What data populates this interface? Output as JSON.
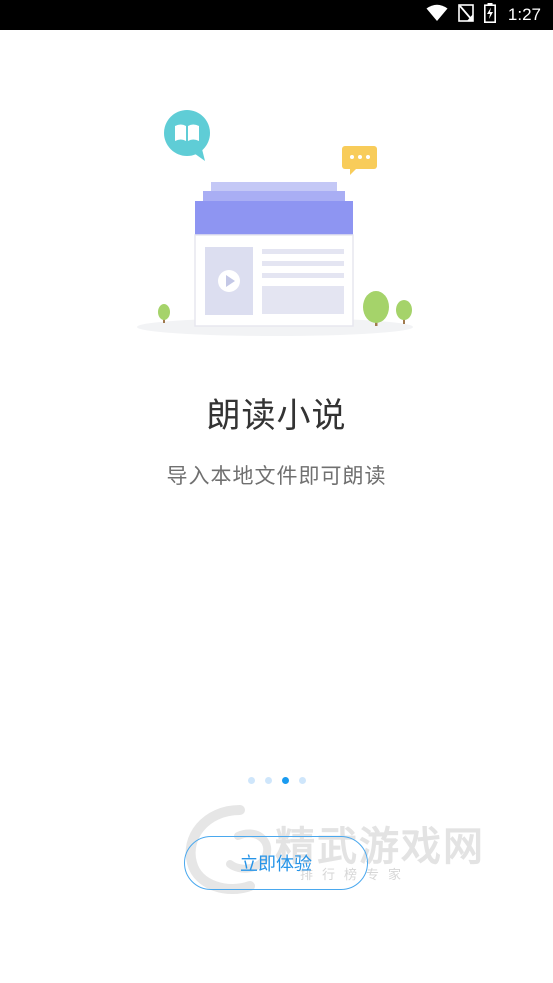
{
  "status_bar": {
    "time": "1:27",
    "icons": [
      "wifi-icon",
      "signal-off-icon",
      "battery-charging-icon"
    ]
  },
  "onboarding": {
    "title": "朗读小说",
    "subtitle": "导入本地文件即可朗读",
    "page_count": 4,
    "active_page": 3,
    "cta_label": "立即体验"
  },
  "watermark": {
    "main": "精武游戏网",
    "sub": "排行榜专家"
  },
  "colors": {
    "accent": "#1a9bf0",
    "button_border": "#4aa8ee",
    "book_header": "#8e95f2",
    "bubble_teal": "#5fcdd6",
    "bubble_yellow": "#f8cc5a",
    "tree_green": "#a5d36a"
  }
}
